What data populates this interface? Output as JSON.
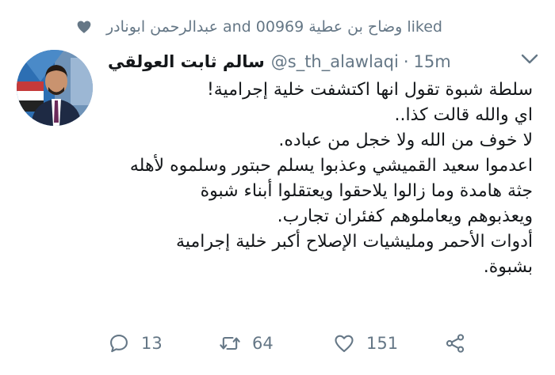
{
  "social_context": {
    "text": "عبدالرحمن ابونادر and وضاح بن عطية 00969 liked",
    "icon": "heart-icon"
  },
  "tweet": {
    "display_name": "سالم ثابت العولقي",
    "handle": "@s_th_alawlaqi",
    "separator": "·",
    "time": "15m",
    "lines": [
      "سلطة شبوة تقول انها اكتشفت خلية إجرامية!",
      "اي والله قالت كذا..",
      "لا خوف من الله ولا خجل من عباده.",
      "اعدموا سعيد القميشي وعذبوا يسلم حبتور وسلموه لأهله",
      "جثة هامدة وما زالوا يلاحقوا ويعتقلوا أبناء شبوة",
      "ويعذبوهم ويعاملوهم كفئران تجارب.",
      "أدوات الأحمر ومليشيات الإصلاح أكبر خلية إجرامية",
      "بشبوة."
    ]
  },
  "actions": {
    "reply_count": "13",
    "retweet_count": "64",
    "like_count": "151"
  },
  "colors": {
    "text": "#14171a",
    "secondary": "#657786",
    "background": "#ffffff"
  }
}
